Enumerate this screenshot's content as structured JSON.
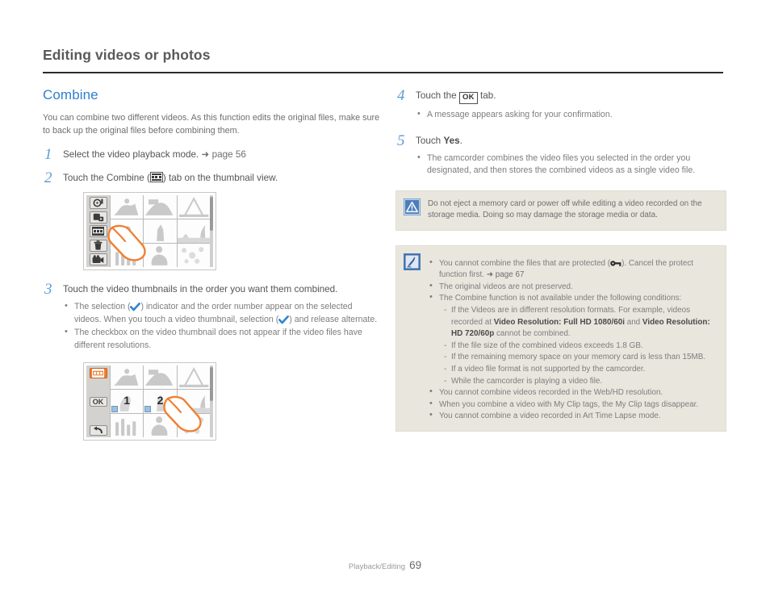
{
  "header": {
    "title": "Editing videos or photos"
  },
  "section": {
    "title": "Combine",
    "intro": "You can combine two different videos. As this function edits the original files, make sure to back up the original files before combining them."
  },
  "steps_left": [
    {
      "num": "1",
      "text_before": "Select the video playback mode. ",
      "ref": "➜ page 56",
      "text_after": ""
    },
    {
      "num": "2",
      "text_before": "Touch the Combine (",
      "icon": "combine-icon",
      "text_after": ") tab on the thumbnail view."
    },
    {
      "num": "3",
      "text_before": "Touch the video thumbnails in the order you want them combined.",
      "bullets": [
        {
          "part1": "The selection (",
          "icon1": "blue-check-icon",
          "part2": ") indicator and the order number appear on the selected videos. When you touch a video thumbnail, selection (",
          "icon2": "blue-check-icon",
          "part3": ") and release alternate."
        },
        {
          "part1": "The checkbox on the video thumbnail does not appear if the video files have different resolutions."
        }
      ]
    }
  ],
  "steps_right": [
    {
      "num": "4",
      "text_before": "Touch the ",
      "ok_label": "OK",
      "text_after": " tab.",
      "bullets": [
        "A message appears asking for your confirmation."
      ]
    },
    {
      "num": "5",
      "text_before": "Touch ",
      "bold": "Yes",
      "text_after": ".",
      "bullets": [
        "The camcorder combines the video files you selected in the order you designated, and then stores the combined videos as a single video file."
      ]
    }
  ],
  "caution_box": {
    "icon": "caution-triangle-icon",
    "text": "Do not eject a memory card or power off while editing a video recorded on the storage media. Doing so may damage the storage media or data."
  },
  "note_box": {
    "icon": "note-pen-icon",
    "bullets": [
      {
        "part1": "You cannot combine the files that are protected (",
        "icon1": "key-protect-icon",
        "part2": "). Cancel the protect function first. ",
        "ref": "➜ page 67"
      },
      {
        "part1": "The original videos are not preserved."
      },
      {
        "part1": "The Combine function is not available under the following conditions:",
        "sub": [
          {
            "a": "If the Videos are in different resolution formats. For example, videos recorded at ",
            "b1": "Video Resolution: Full HD 1080/60i",
            "c": " and ",
            "b2": "Video Resolution: HD 720/60p",
            "d": " cannot be combined."
          },
          {
            "a": "If the file size of the combined videos exceeds 1.8 GB."
          },
          {
            "a": "If the remaining memory space on your memory card is less than 15MB."
          },
          {
            "a": "If a video file format is not supported by the camcorder."
          },
          {
            "a": "While the camcorder is playing a video file."
          }
        ]
      },
      {
        "part1": "You cannot combine videos recorded in the Web/HD resolution."
      },
      {
        "part1": "When you combine a video with My Clip tags, the My Clip tags disappear."
      },
      {
        "part1": "You cannot combine a video recorded in Art Time Lapse mode."
      }
    ]
  },
  "cam_screen_1": {
    "tabs": [
      {
        "name": "photo-play-tab",
        "selected": false
      },
      {
        "name": "share-mark-tab",
        "selected": false
      },
      {
        "name": "combine-tab",
        "selected": false
      },
      {
        "name": "delete-tab",
        "selected": false
      },
      {
        "name": "camcorder-tab",
        "selected": false
      }
    ]
  },
  "cam_screen_2": {
    "tabs": [
      {
        "name": "combine-tab",
        "selected": true
      },
      {
        "name": "ok-tab",
        "label": "OK",
        "selected": false
      },
      {
        "name": "back-tab",
        "selected": false
      }
    ],
    "order_numbers": [
      "1",
      "2"
    ]
  },
  "footer": {
    "section": "Playback/Editing",
    "page": "69"
  },
  "colors": {
    "accent_blue": "#2f7fd0",
    "step_number_blue": "#5b9bd5",
    "box_bg": "#e9e6dd",
    "orange": "#ef8033",
    "check_blue": "#2f84d0"
  }
}
